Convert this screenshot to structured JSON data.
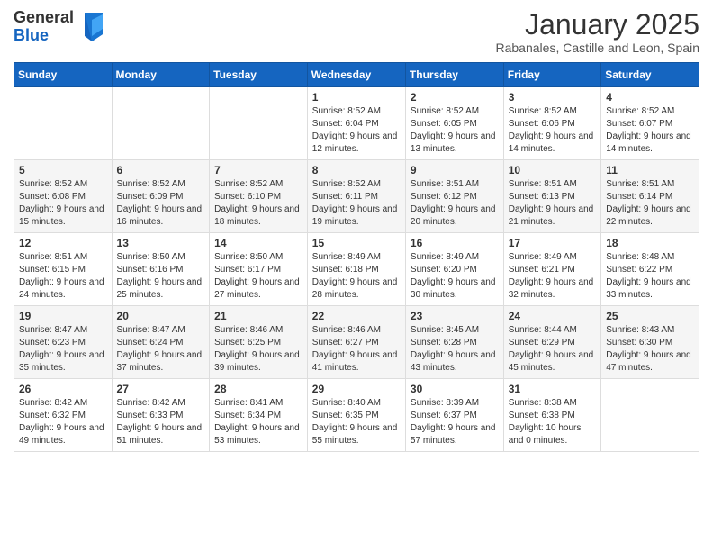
{
  "header": {
    "logo_general": "General",
    "logo_blue": "Blue",
    "month_title": "January 2025",
    "subtitle": "Rabanales, Castille and Leon, Spain"
  },
  "days_of_week": [
    "Sunday",
    "Monday",
    "Tuesday",
    "Wednesday",
    "Thursday",
    "Friday",
    "Saturday"
  ],
  "weeks": [
    [
      {
        "day": "",
        "info": ""
      },
      {
        "day": "",
        "info": ""
      },
      {
        "day": "",
        "info": ""
      },
      {
        "day": "1",
        "info": "Sunrise: 8:52 AM\nSunset: 6:04 PM\nDaylight: 9 hours and 12 minutes."
      },
      {
        "day": "2",
        "info": "Sunrise: 8:52 AM\nSunset: 6:05 PM\nDaylight: 9 hours and 13 minutes."
      },
      {
        "day": "3",
        "info": "Sunrise: 8:52 AM\nSunset: 6:06 PM\nDaylight: 9 hours and 14 minutes."
      },
      {
        "day": "4",
        "info": "Sunrise: 8:52 AM\nSunset: 6:07 PM\nDaylight: 9 hours and 14 minutes."
      }
    ],
    [
      {
        "day": "5",
        "info": "Sunrise: 8:52 AM\nSunset: 6:08 PM\nDaylight: 9 hours and 15 minutes."
      },
      {
        "day": "6",
        "info": "Sunrise: 8:52 AM\nSunset: 6:09 PM\nDaylight: 9 hours and 16 minutes."
      },
      {
        "day": "7",
        "info": "Sunrise: 8:52 AM\nSunset: 6:10 PM\nDaylight: 9 hours and 18 minutes."
      },
      {
        "day": "8",
        "info": "Sunrise: 8:52 AM\nSunset: 6:11 PM\nDaylight: 9 hours and 19 minutes."
      },
      {
        "day": "9",
        "info": "Sunrise: 8:51 AM\nSunset: 6:12 PM\nDaylight: 9 hours and 20 minutes."
      },
      {
        "day": "10",
        "info": "Sunrise: 8:51 AM\nSunset: 6:13 PM\nDaylight: 9 hours and 21 minutes."
      },
      {
        "day": "11",
        "info": "Sunrise: 8:51 AM\nSunset: 6:14 PM\nDaylight: 9 hours and 22 minutes."
      }
    ],
    [
      {
        "day": "12",
        "info": "Sunrise: 8:51 AM\nSunset: 6:15 PM\nDaylight: 9 hours and 24 minutes."
      },
      {
        "day": "13",
        "info": "Sunrise: 8:50 AM\nSunset: 6:16 PM\nDaylight: 9 hours and 25 minutes."
      },
      {
        "day": "14",
        "info": "Sunrise: 8:50 AM\nSunset: 6:17 PM\nDaylight: 9 hours and 27 minutes."
      },
      {
        "day": "15",
        "info": "Sunrise: 8:49 AM\nSunset: 6:18 PM\nDaylight: 9 hours and 28 minutes."
      },
      {
        "day": "16",
        "info": "Sunrise: 8:49 AM\nSunset: 6:20 PM\nDaylight: 9 hours and 30 minutes."
      },
      {
        "day": "17",
        "info": "Sunrise: 8:49 AM\nSunset: 6:21 PM\nDaylight: 9 hours and 32 minutes."
      },
      {
        "day": "18",
        "info": "Sunrise: 8:48 AM\nSunset: 6:22 PM\nDaylight: 9 hours and 33 minutes."
      }
    ],
    [
      {
        "day": "19",
        "info": "Sunrise: 8:47 AM\nSunset: 6:23 PM\nDaylight: 9 hours and 35 minutes."
      },
      {
        "day": "20",
        "info": "Sunrise: 8:47 AM\nSunset: 6:24 PM\nDaylight: 9 hours and 37 minutes."
      },
      {
        "day": "21",
        "info": "Sunrise: 8:46 AM\nSunset: 6:25 PM\nDaylight: 9 hours and 39 minutes."
      },
      {
        "day": "22",
        "info": "Sunrise: 8:46 AM\nSunset: 6:27 PM\nDaylight: 9 hours and 41 minutes."
      },
      {
        "day": "23",
        "info": "Sunrise: 8:45 AM\nSunset: 6:28 PM\nDaylight: 9 hours and 43 minutes."
      },
      {
        "day": "24",
        "info": "Sunrise: 8:44 AM\nSunset: 6:29 PM\nDaylight: 9 hours and 45 minutes."
      },
      {
        "day": "25",
        "info": "Sunrise: 8:43 AM\nSunset: 6:30 PM\nDaylight: 9 hours and 47 minutes."
      }
    ],
    [
      {
        "day": "26",
        "info": "Sunrise: 8:42 AM\nSunset: 6:32 PM\nDaylight: 9 hours and 49 minutes."
      },
      {
        "day": "27",
        "info": "Sunrise: 8:42 AM\nSunset: 6:33 PM\nDaylight: 9 hours and 51 minutes."
      },
      {
        "day": "28",
        "info": "Sunrise: 8:41 AM\nSunset: 6:34 PM\nDaylight: 9 hours and 53 minutes."
      },
      {
        "day": "29",
        "info": "Sunrise: 8:40 AM\nSunset: 6:35 PM\nDaylight: 9 hours and 55 minutes."
      },
      {
        "day": "30",
        "info": "Sunrise: 8:39 AM\nSunset: 6:37 PM\nDaylight: 9 hours and 57 minutes."
      },
      {
        "day": "31",
        "info": "Sunrise: 8:38 AM\nSunset: 6:38 PM\nDaylight: 10 hours and 0 minutes."
      },
      {
        "day": "",
        "info": ""
      }
    ]
  ]
}
